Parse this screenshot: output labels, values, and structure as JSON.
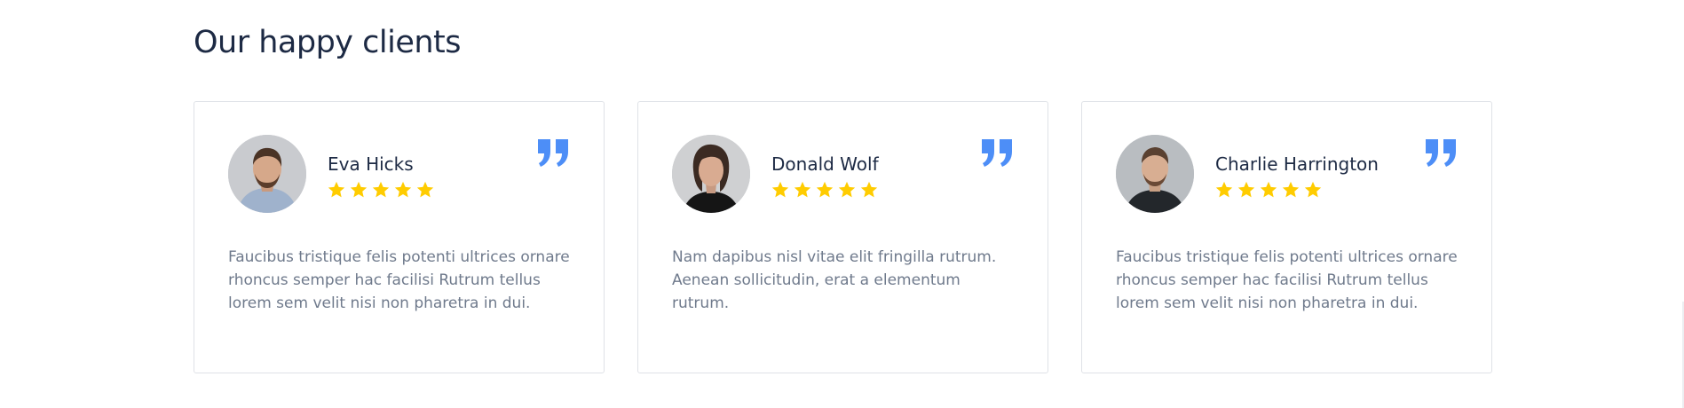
{
  "section": {
    "title": "Our happy clients"
  },
  "colors": {
    "title": "#1d2a44",
    "body_text": "#6f7a8c",
    "star": "#ffcc00",
    "quote": "#4d8ef7",
    "card_border": "#dfe2e7"
  },
  "testimonials": [
    {
      "name": "Eva Hicks",
      "rating": 5,
      "avatar_icon": "avatar-photo",
      "text": "Faucibus tristique felis potenti ultrices ornare rhoncus semper hac facilisi Rutrum tellus lorem sem velit nisi non pharetra in dui."
    },
    {
      "name": "Donald Wolf",
      "rating": 5,
      "avatar_icon": "avatar-photo",
      "text": "Nam dapibus nisl vitae elit fringilla rutrum. Aenean sollicitudin, erat a elementum rutrum."
    },
    {
      "name": "Charlie Harrington",
      "rating": 5,
      "avatar_icon": "avatar-photo",
      "text": "Faucibus tristique felis potenti ultrices ornare rhoncus semper hac facilisi Rutrum tellus lorem sem velit nisi non pharetra in dui."
    }
  ]
}
